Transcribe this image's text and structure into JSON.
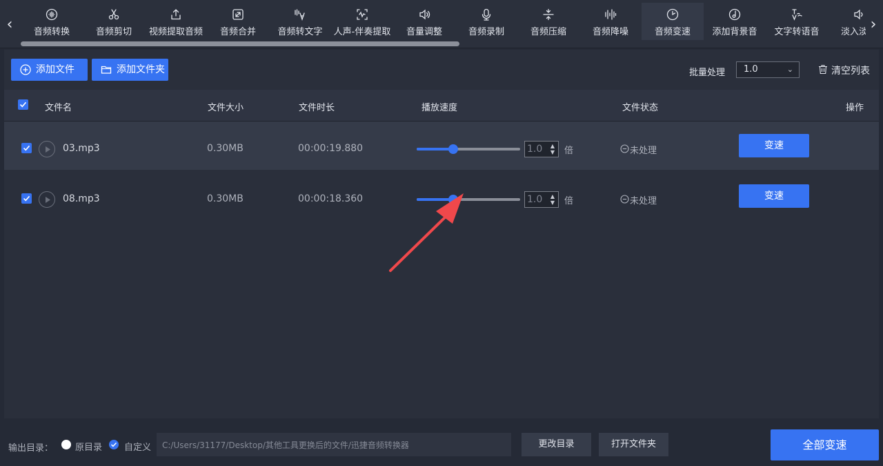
{
  "toolbar": {
    "tools": [
      {
        "label": "音频转换",
        "icon": "audio-wave-icon"
      },
      {
        "label": "音频剪切",
        "icon": "scissors-icon"
      },
      {
        "label": "视频提取音频",
        "icon": "upload-icon"
      },
      {
        "label": "音频合并",
        "icon": "merge-icon"
      },
      {
        "label": "音频转文字",
        "icon": "audio-text-icon"
      },
      {
        "label": "人声-伴奏提取",
        "icon": "waveform-scan-icon"
      },
      {
        "label": "音量调整",
        "icon": "speaker-icon"
      },
      {
        "label": "音频录制",
        "icon": "microphone-icon"
      },
      {
        "label": "音频压缩",
        "icon": "compress-icon"
      },
      {
        "label": "音频降噪",
        "icon": "equalizer-icon"
      },
      {
        "label": "音频变速",
        "icon": "clock-icon"
      },
      {
        "label": "添加背景音",
        "icon": "music-note-icon"
      },
      {
        "label": "文字转语音",
        "icon": "text-speech-icon"
      },
      {
        "label": "淡入淡出",
        "icon": "fade-speaker-icon"
      }
    ],
    "active_index": 10,
    "prev_arrow": "‹",
    "next_arrow": "›"
  },
  "actions": {
    "add_file": "添加文件",
    "add_folder": "添加文件夹",
    "batch_label": "批量处理",
    "batch_value": "1.0",
    "clear_list": "清空列表"
  },
  "table": {
    "headers": {
      "name": "文件名",
      "size": "文件大小",
      "duration": "文件时长",
      "speed": "播放速度",
      "status": "文件状态",
      "action": "操作"
    },
    "rows": [
      {
        "name": "03.mp3",
        "size": "0.30MB",
        "duration": "00:00:19.880",
        "speed": "1.0",
        "speed_fraction": 0.35,
        "unit": "倍",
        "status": "未处理",
        "action": "变速",
        "checked": true
      },
      {
        "name": "08.mp3",
        "size": "0.30MB",
        "duration": "00:00:18.360",
        "speed": "1.0",
        "speed_fraction": 0.35,
        "unit": "倍",
        "status": "未处理",
        "action": "变速",
        "checked": true
      }
    ]
  },
  "footer": {
    "output_label": "输出目录：",
    "radio_original": "原目录",
    "radio_custom": "自定义",
    "selected_radio": "custom",
    "path": "C:/Users/31177/Desktop/其他工具更换后的文件/迅捷音频转换器",
    "change_dir": "更改目录",
    "open_folder": "打开文件夹",
    "convert_all": "全部变速"
  },
  "colors": {
    "accent": "#3773f2",
    "annotation_arrow": "#f0484b"
  }
}
